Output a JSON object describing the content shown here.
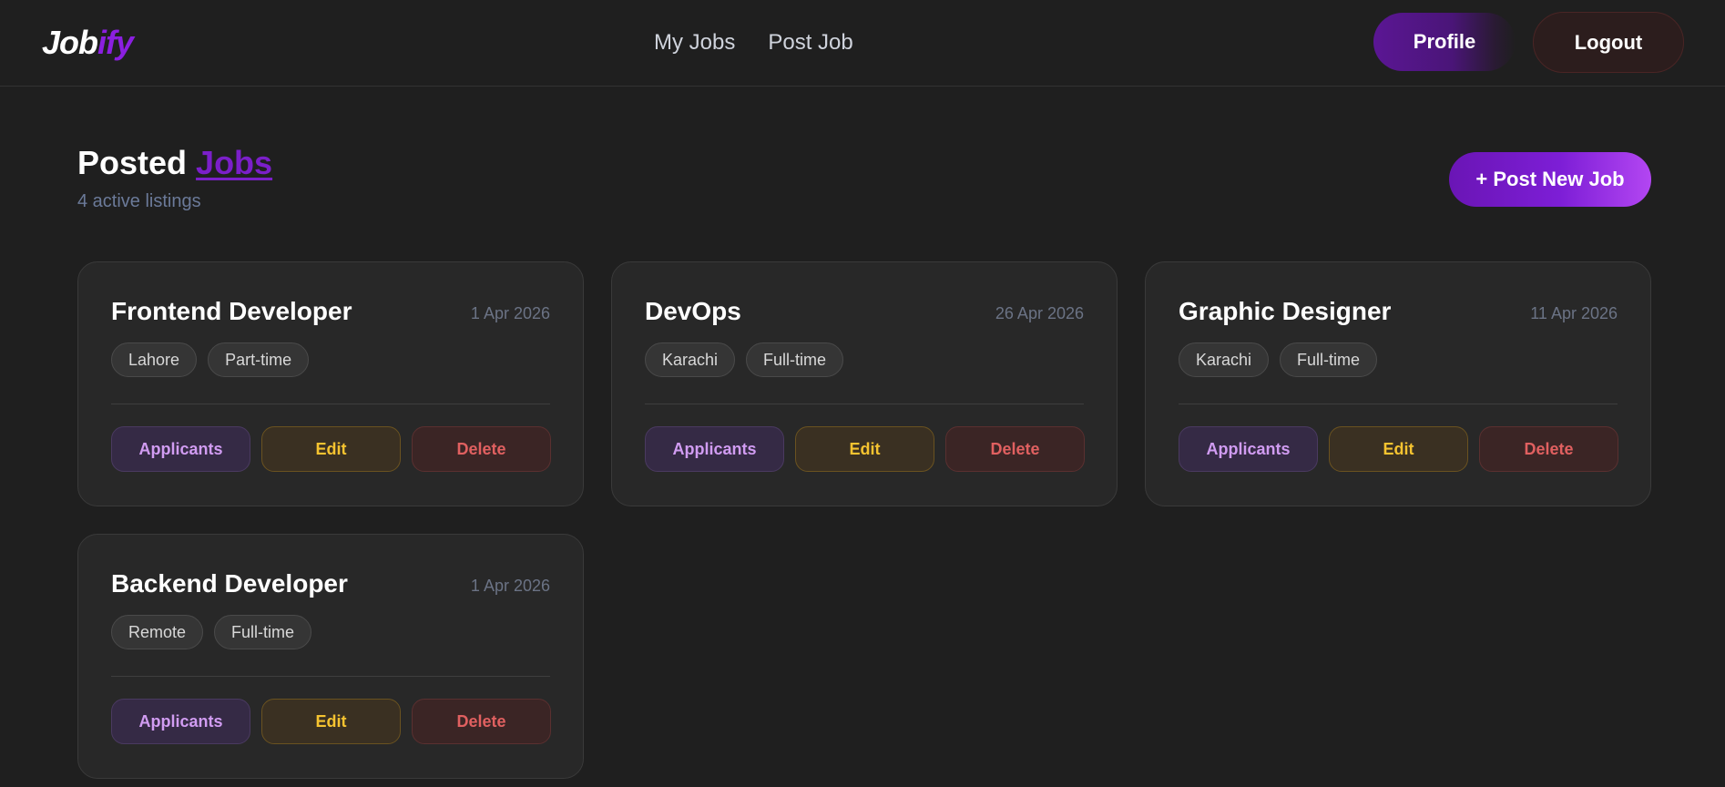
{
  "nav": {
    "logo_main": "Job",
    "logo_accent": "ify",
    "links": [
      "My Jobs",
      "Post Job"
    ],
    "profile_label": "Profile",
    "logout_label": "Logout"
  },
  "header": {
    "title_main": "Posted",
    "title_accent": "Jobs",
    "subtitle": "4 active listings",
    "post_new_label": "+ Post New Job"
  },
  "actions": {
    "applicants_label": "Applicants",
    "edit_label": "Edit",
    "delete_label": "Delete"
  },
  "jobs": [
    {
      "title": "Frontend Developer",
      "date": "1 Apr 2026",
      "tags": [
        "Lahore",
        "Part-time"
      ]
    },
    {
      "title": "DevOps",
      "date": "26 Apr 2026",
      "tags": [
        "Karachi",
        "Full-time"
      ]
    },
    {
      "title": "Graphic Designer",
      "date": "11 Apr 2026",
      "tags": [
        "Karachi",
        "Full-time"
      ]
    },
    {
      "title": "Backend Developer",
      "date": "1 Apr 2026",
      "tags": [
        "Remote",
        "Full-time"
      ]
    }
  ],
  "colors": {
    "brand_purple": "#8b1fe0",
    "edit_yellow": "#f5c330",
    "delete_red": "#e06060",
    "applicants_violet": "#d19cf2"
  }
}
